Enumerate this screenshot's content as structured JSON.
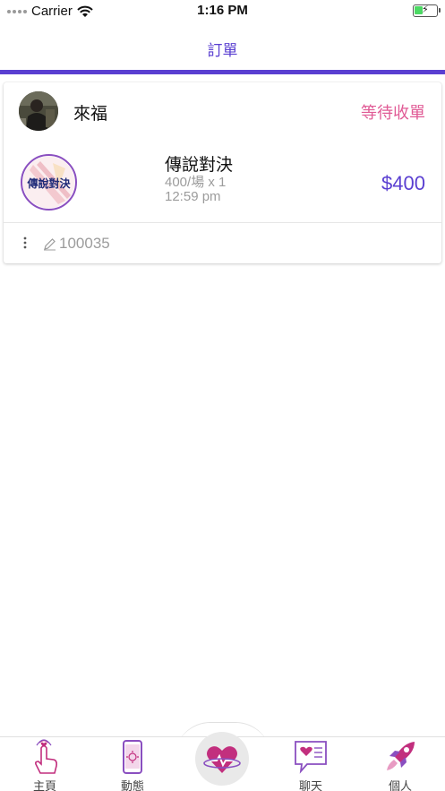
{
  "status_bar": {
    "carrier": "Carrier",
    "time": "1:16 PM",
    "battery_color": "#4cd964"
  },
  "nav": {
    "title": "訂單",
    "accent_color": "#5a3fd1"
  },
  "order": {
    "buyer_name": "來福",
    "status": "等待收單",
    "status_color": "#e05a95",
    "game_logo_text": "傳說對決",
    "game_name": "傳說對決",
    "rate": "400/場 x 1",
    "time": "12:59 pm",
    "price": "$400",
    "price_color": "#5a3fd1",
    "order_id": "100035",
    "icons": [
      "avatar-photo",
      "game-logo",
      "more-vertical-icon",
      "edit-pencil-icon"
    ]
  },
  "tab_bar": {
    "tabs": [
      {
        "label": "主頁",
        "icon": "touch-hand-icon"
      },
      {
        "label": "動態",
        "icon": "phone-feed-icon"
      },
      {
        "label": "",
        "icon": "heart-orbit-icon"
      },
      {
        "label": "聊天",
        "icon": "chat-bubble-icon"
      },
      {
        "label": "個人",
        "icon": "rocket-icon"
      }
    ]
  }
}
